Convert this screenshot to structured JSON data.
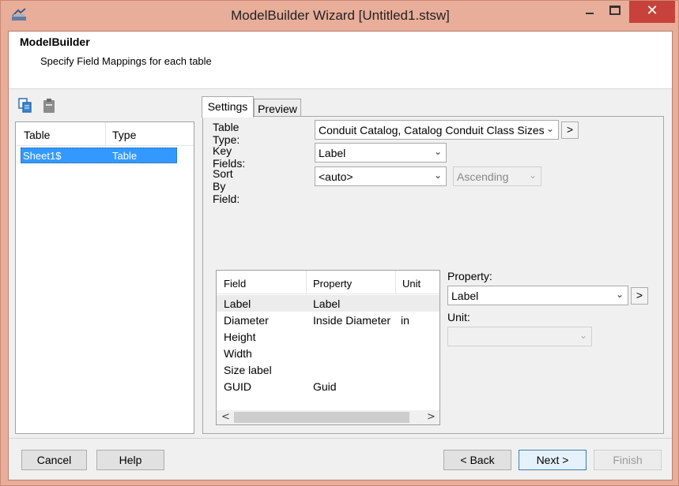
{
  "window": {
    "title": "ModelBuilder Wizard [Untitled1.stsw]",
    "close_glyph": "✕"
  },
  "header": {
    "title": "ModelBuilder",
    "subtitle": "Specify Field Mappings for each table"
  },
  "toolbar": {
    "icons": [
      "copy-icon",
      "paste-icon"
    ]
  },
  "table_list": {
    "columns": [
      "Table",
      "Type"
    ],
    "rows": [
      {
        "table": "Sheet1$",
        "type": "Table",
        "selected": true
      }
    ]
  },
  "tabs": [
    {
      "label": "Settings",
      "active": true
    },
    {
      "label": "Preview",
      "active": false
    }
  ],
  "settings": {
    "table_type_label": "Table Type:",
    "table_type_value": "Conduit Catalog, Catalog Conduit Class Sizes",
    "key_fields_label": "Key Fields:",
    "key_fields_value": "Label",
    "sort_by_label": "Sort By Field:",
    "sort_by_value": "<auto>",
    "sort_order_value": "Ascending",
    "more_glyph": ">"
  },
  "mapping": {
    "columns": [
      "Field",
      "Property",
      "Unit"
    ],
    "rows": [
      {
        "field": "Label",
        "property": "Label",
        "unit": ""
      },
      {
        "field": "Diameter",
        "property": "Inside Diameter",
        "unit": "in"
      },
      {
        "field": "Height",
        "property": "",
        "unit": ""
      },
      {
        "field": "Width",
        "property": "",
        "unit": ""
      },
      {
        "field": "Size label",
        "property": "",
        "unit": ""
      },
      {
        "field": "GUID",
        "property": "Guid",
        "unit": ""
      }
    ],
    "scroll_left": "<",
    "scroll_right": ">"
  },
  "property_panel": {
    "property_label": "Property:",
    "property_value": "Label",
    "unit_label": "Unit:",
    "unit_value": ""
  },
  "buttons": {
    "cancel": "Cancel",
    "help": "Help",
    "back": "< Back",
    "next": "Next >",
    "finish": "Finish"
  },
  "colors": {
    "frame": "#e8ae99",
    "close": "#c7423a",
    "selection": "#3399ff"
  }
}
